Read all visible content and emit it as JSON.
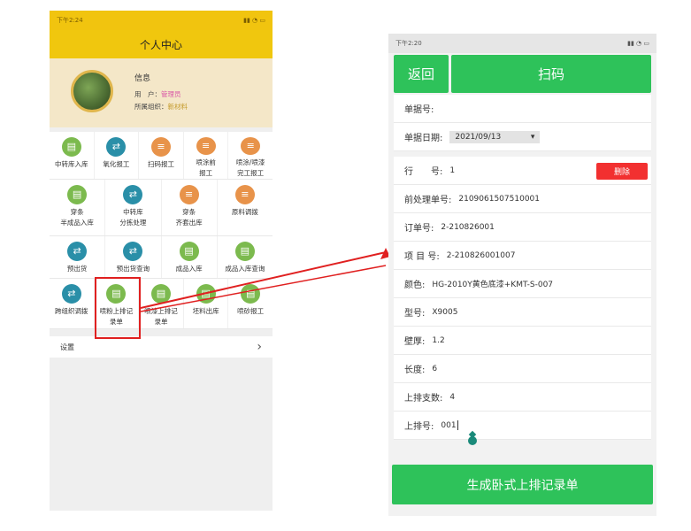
{
  "left": {
    "status_time": "下午2:24",
    "header_title": "个人中心",
    "profile": {
      "info_title": "信息",
      "user_label": "用　户：",
      "user_value": "管理员",
      "org_label": "所属组织：",
      "org_value": "新材料"
    },
    "grid": [
      [
        {
          "label": "中转库入库",
          "icon": "document-icon",
          "color": "green"
        },
        {
          "label": "氧化报工",
          "icon": "transfer-icon",
          "color": "teal"
        },
        {
          "label": "扫码报工",
          "icon": "database-icon",
          "color": "orange"
        },
        {
          "label": "喷涂前\n报工",
          "icon": "database-icon",
          "color": "orange"
        },
        {
          "label": "喷涂/喷漆\n完工报工",
          "icon": "database-icon",
          "color": "orange"
        }
      ],
      [
        {
          "label": "穿条\n半成品入库",
          "icon": "document-icon",
          "color": "green"
        },
        {
          "label": "中转库\n分拣处理",
          "icon": "transfer-icon",
          "color": "teal"
        },
        {
          "label": "穿条\n齐套出库",
          "icon": "database-icon",
          "color": "orange"
        },
        {
          "label": "原料调拨",
          "icon": "database-icon",
          "color": "orange"
        }
      ],
      [
        {
          "label": "预出货",
          "icon": "transfer-icon",
          "color": "teal"
        },
        {
          "label": "预出货查询",
          "icon": "transfer-icon",
          "color": "teal"
        },
        {
          "label": "成品入库",
          "icon": "document-icon",
          "color": "green"
        },
        {
          "label": "成品入库查询",
          "icon": "document-icon",
          "color": "green"
        }
      ],
      [
        {
          "label": "跨组织调拨",
          "icon": "transfer-icon",
          "color": "teal"
        },
        {
          "label": "喷粉上排记\n录单",
          "icon": "document-icon",
          "color": "green"
        },
        {
          "label": "喷漆上排记\n录单",
          "icon": "document-icon",
          "color": "green"
        },
        {
          "label": "坯料出库",
          "icon": "document-icon",
          "color": "green"
        },
        {
          "label": "喷砂报工",
          "icon": "document-icon",
          "color": "green"
        }
      ]
    ],
    "settings_label": "设置",
    "settings_chevron": "›"
  },
  "right": {
    "status_time": "下午2:20",
    "back_label": "返回",
    "scan_label": "扫码",
    "doc_no_label": "单据号:",
    "doc_date_label": "单据日期:",
    "doc_date_value": "2021/09/13",
    "line_label": "行　　号:",
    "line_value": "1",
    "delete_label": "删除",
    "pre_no_label": "前处理单号:",
    "pre_no_value": "2109061507510001",
    "order_label": "订单号:",
    "order_value": "2-210826001",
    "item_label": "项  目 号:",
    "item_value": "2-210826001007",
    "color_label": "颜色:",
    "color_value": "HG-2010Y黄色底漆+KMT-S-007",
    "model_label": "型号:",
    "model_value": "X9005",
    "thick_label": "壁厚:",
    "thick_value": "1.2",
    "length_label": "长度:",
    "length_value": "6",
    "count_label": "上排支数:",
    "count_value": "4",
    "rowno_label": "上排号:",
    "rowno_value": "001",
    "generate_label": "生成卧式上排记录单"
  },
  "colors": {
    "header_yellow": "#f0c70e",
    "green_button": "#2ec25a",
    "delete_red": "#f23030",
    "highlight_red": "#e02020"
  }
}
